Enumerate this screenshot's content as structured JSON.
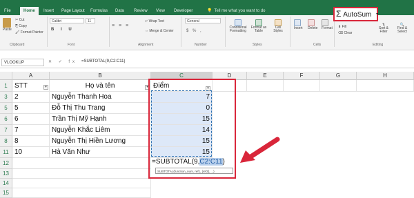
{
  "tabs": [
    "File",
    "Home",
    "Insert",
    "Page Layout",
    "Formulas",
    "Data",
    "Review",
    "View",
    "Developer"
  ],
  "active_tab": "Home",
  "tell_me": "Tell me what you want to do",
  "ribbon": {
    "paste": "Paste",
    "cut": "Cut",
    "copy": "Copy",
    "format_painter": "Format Painter",
    "font": "Calibri",
    "font_size": "11",
    "wrap_text": "Wrap Text",
    "merge_center": "Merge & Center",
    "number_format": "General",
    "conditional_formatting": "Conditional Formatting",
    "format_as_table": "Format as Table",
    "cell_styles": "Cell Styles",
    "insert": "Insert",
    "delete": "Delete",
    "format": "Format",
    "autosum": "AutoSum",
    "fill": "Fill",
    "clear": "Clear",
    "sort_filter": "Sort & Filter",
    "find_select": "Find & Select",
    "groups": {
      "clipboard": "Clipboard",
      "font": "Font",
      "alignment": "Alignment",
      "number": "Number",
      "styles": "Styles",
      "cells": "Cells",
      "editing": "Editing"
    }
  },
  "name_box": "VLOOKUP",
  "formula_icons": "✕ ✓ fx",
  "formula_bar": "=SUBTOTAL(9,C2:C11)",
  "columns": [
    "A",
    "B",
    "C",
    "D",
    "E",
    "F",
    "G",
    "H"
  ],
  "rows": [
    "1",
    "3",
    "5",
    "6",
    "7",
    "8",
    "9",
    "11",
    "12",
    "13",
    "14",
    "15"
  ],
  "header_row": {
    "stt": "STT",
    "name": "Họ và tên",
    "score": "Điểm",
    "filter": "▾"
  },
  "data": [
    {
      "stt": "2",
      "name": "Nguyễn Thanh Hoa",
      "score": "7"
    },
    {
      "stt": "5",
      "name": "Đỗ Thị Thu Trang",
      "score": "0"
    },
    {
      "stt": "6",
      "name": "Trần Thị Mỹ Hạnh",
      "score": "15"
    },
    {
      "stt": "7",
      "name": "Nguyễn Khắc Liêm",
      "score": "14"
    },
    {
      "stt": "8",
      "name": "Nguyễn Thị Hiền Lương",
      "score": "15"
    },
    {
      "stt": "10",
      "name": "Hà Văn Như",
      "score": "15"
    }
  ],
  "edit_formula": {
    "prefix": "=SUBTOTAL(9,",
    "range": "C2:C11",
    "suffix": ")"
  },
  "tooltip": "SUBTOTAL(function_num, ref1, [ref2], ...)",
  "colors": {
    "excel_green": "#217346",
    "highlight_red": "#d9263a",
    "selection_blue": "#dde8f8"
  }
}
